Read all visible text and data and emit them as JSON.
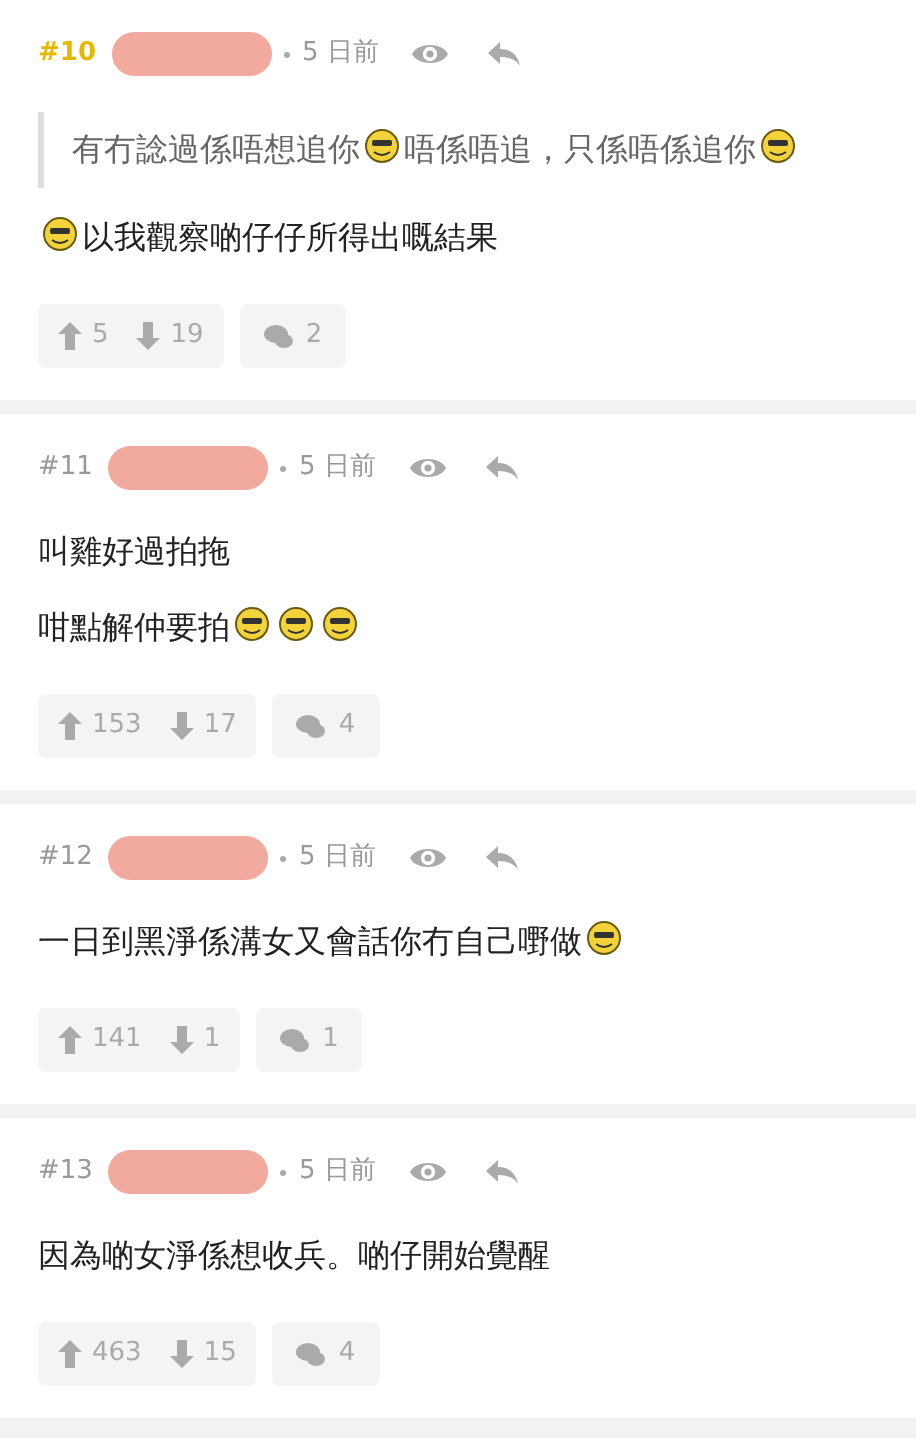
{
  "posts": [
    {
      "number": "#10",
      "highlighted": true,
      "time": "5 日前",
      "lines": [
        {
          "kind": "quote",
          "parts": [
            {
              "kind": "text",
              "text": "有冇諗過係唔想追你"
            },
            {
              "kind": "emoji"
            },
            {
              "kind": "text",
              "text": "唔係唔追，只係唔係追你"
            },
            {
              "kind": "emoji"
            }
          ]
        },
        {
          "kind": "text",
          "parts": [
            {
              "kind": "emoji"
            },
            {
              "kind": "text",
              "text": "以我觀察啲仔仔所得出嘅結果"
            }
          ]
        }
      ],
      "up": "5",
      "down": "19",
      "replies": "2"
    },
    {
      "number": "#11",
      "highlighted": false,
      "time": "5 日前",
      "lines": [
        {
          "kind": "text",
          "parts": [
            {
              "kind": "text",
              "text": "叫雞好過拍拖"
            }
          ]
        },
        {
          "kind": "text",
          "parts": [
            {
              "kind": "text",
              "text": "咁點解仲要拍"
            },
            {
              "kind": "emoji"
            },
            {
              "kind": "emoji"
            },
            {
              "kind": "emoji"
            }
          ]
        }
      ],
      "up": "153",
      "down": "17",
      "replies": "4"
    },
    {
      "number": "#12",
      "highlighted": false,
      "time": "5 日前",
      "lines": [
        {
          "kind": "text",
          "parts": [
            {
              "kind": "text",
              "text": "一日到黑淨係溝女又會話你冇自己嘢做"
            },
            {
              "kind": "emoji"
            }
          ]
        }
      ],
      "up": "141",
      "down": "1",
      "replies": "1"
    },
    {
      "number": "#13",
      "highlighted": false,
      "time": "5 日前",
      "lines": [
        {
          "kind": "text",
          "parts": [
            {
              "kind": "text",
              "text": "因為啲女淨係想收兵。啲仔開始覺醒"
            }
          ]
        }
      ],
      "up": "463",
      "down": "15",
      "replies": "4"
    }
  ]
}
